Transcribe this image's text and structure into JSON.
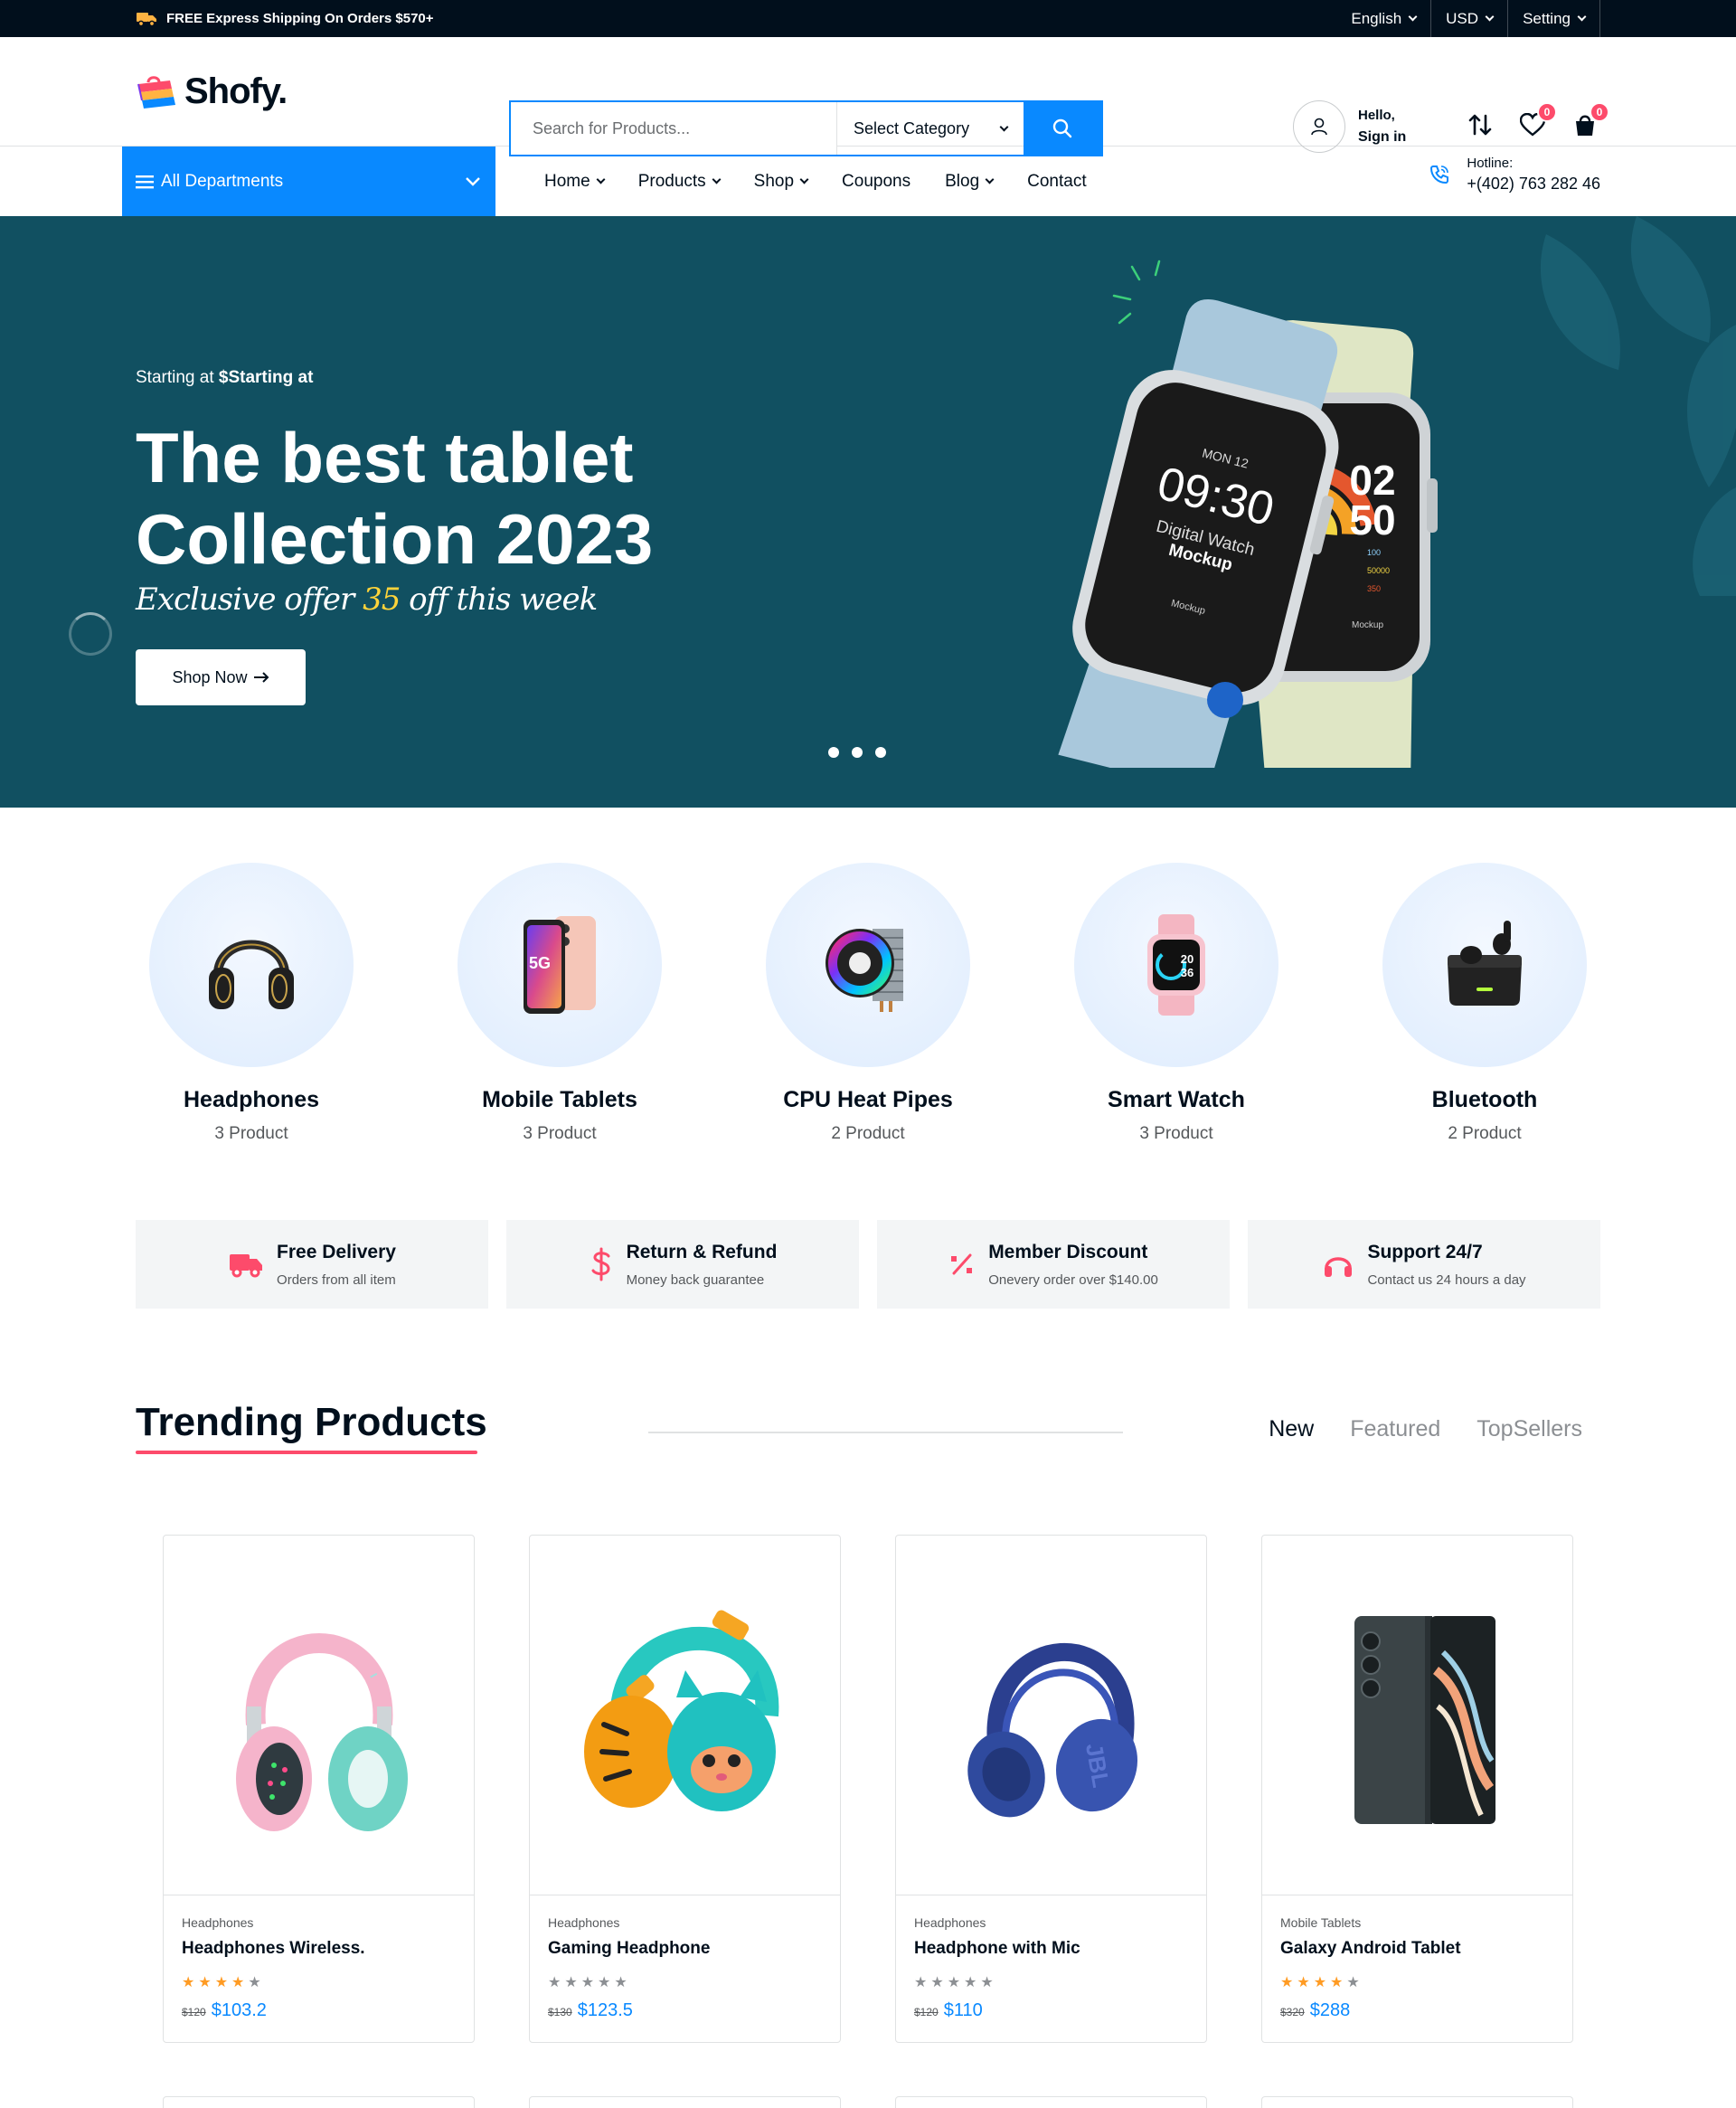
{
  "topbar": {
    "shipping_text": "FREE Express Shipping On Orders $570+",
    "language": "English",
    "currency": "USD",
    "setting": "Setting"
  },
  "header": {
    "logo": "Shofy.",
    "search_placeholder": "Search for Products...",
    "category_select": "Select Category",
    "account_hello": "Hello,",
    "account_signin": "Sign in",
    "wishlist_count": "0",
    "cart_count": "0"
  },
  "nav": {
    "departments": "All Departments",
    "menu": [
      "Home",
      "Products",
      "Shop",
      "Coupons",
      "Blog",
      "Contact"
    ],
    "hotline_label": "Hotline:",
    "hotline_number": "+(402) 763 282 46"
  },
  "hero": {
    "starting_prefix": "Starting at",
    "starting_value": "$Starting at",
    "title": "The best tablet Collection 2023",
    "offer_before": "Exclusive offer ",
    "offer_highlight": "35",
    "offer_after": " off this week",
    "button": "Shop Now",
    "watch_left_day": "MON 12",
    "watch_left_time": "09:30",
    "watch_left_line1": "Digital Watch",
    "watch_left_line2": "Mockup",
    "watch_left_brand": "Mockup",
    "watch_right_hour": "02",
    "watch_right_min": "50",
    "watch_right_stat1": "100",
    "watch_right_stat2": "50000",
    "watch_right_stat3": "350",
    "watch_right_brand": "Mockup"
  },
  "categories": [
    {
      "name": "Headphones",
      "count": "3 Product",
      "icon": "headphones-icon"
    },
    {
      "name": "Mobile Tablets",
      "count": "3 Product",
      "icon": "phone-icon"
    },
    {
      "name": "CPU Heat Pipes",
      "count": "2 Product",
      "icon": "cpu-cooler-icon"
    },
    {
      "name": "Smart Watch",
      "count": "3 Product",
      "icon": "smartwatch-icon"
    },
    {
      "name": "Bluetooth",
      "count": "2 Product",
      "icon": "earbuds-icon"
    }
  ],
  "features": [
    {
      "title": "Free Delivery",
      "subtitle": "Orders from all item",
      "icon": "truck-icon"
    },
    {
      "title": "Return & Refund",
      "subtitle": "Money back guarantee",
      "icon": "dollar-icon"
    },
    {
      "title": "Member Discount",
      "subtitle": "Onevery order over $140.00",
      "icon": "percent-icon"
    },
    {
      "title": "Support 24/7",
      "subtitle": "Contact us 24 hours a day",
      "icon": "headset-icon"
    }
  ],
  "trending": {
    "title": "Trending Products",
    "tabs": [
      "New",
      "Featured",
      "TopSellers"
    ],
    "products": [
      {
        "category": "Headphones",
        "name": "Headphones Wireless.",
        "old_price": "$120",
        "price": "$103.2",
        "rating": 4
      },
      {
        "category": "Headphones",
        "name": "Gaming Headphone",
        "old_price": "$130",
        "price": "$123.5",
        "rating": 0
      },
      {
        "category": "Headphones",
        "name": "Headphone with Mic",
        "old_price": "$120",
        "price": "$110",
        "rating": 0
      },
      {
        "category": "Mobile Tablets",
        "name": "Galaxy Android Tablet",
        "old_price": "$320",
        "price": "$288",
        "rating": 4
      }
    ]
  },
  "colors": {
    "primary": "#0989ff",
    "hero_bg": "#115061",
    "dark": "#010f1c",
    "pink": "#fd4b6b",
    "star": "#ff9b23"
  }
}
